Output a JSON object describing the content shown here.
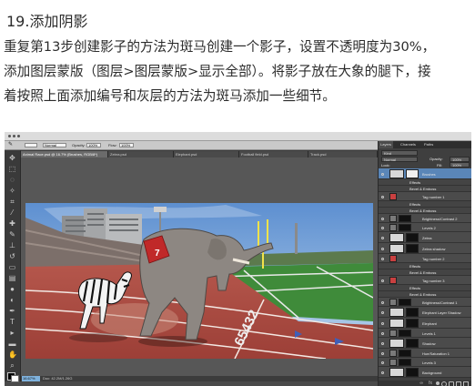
{
  "tutorial": {
    "step_title": "19.添加阴影",
    "lines": [
      "重复第13步创建影子的方法为斑马创建一个影子，设置不透明度为30%，",
      "添加图层蒙版（图层>图层蒙版>显示全部）。将影子放在大象的腿下，接",
      "着按照上面添加编号和灰层的方法为斑马添加一些细节。"
    ]
  },
  "photoshop": {
    "options_bar": {
      "mode": "Normal",
      "opacity_label": "Opacity:",
      "opacity": "100%",
      "flow_label": "Flow:",
      "flow": "100%",
      "workspace": "Essentials"
    },
    "document_tabs": [
      "Animal Race.psd @ 16.7% (Brushes, RGB/8*)",
      "Zebra.psd",
      "Elephant.psd",
      "Football field.psd",
      "Track.psd"
    ],
    "status": {
      "zoom": "16.67%",
      "text": "Doc: 42.2M/1.26G"
    },
    "panels": {
      "tabs": [
        "Layers",
        "Channels",
        "Paths"
      ],
      "filter_label": "Kind",
      "blend_mode": "Normal",
      "opacity_label": "Opacity:",
      "opacity": "100%",
      "lock_label": "Lock:",
      "fill_label": "Fill:",
      "fill": "100%",
      "layers": [
        {
          "name": "Brushes",
          "type": "main",
          "selected": true
        },
        {
          "name": "Effects",
          "type": "sub"
        },
        {
          "name": "Bevel & Emboss",
          "type": "sub"
        },
        {
          "name": "Tag number 1",
          "type": "text"
        },
        {
          "name": "Effects",
          "type": "sub"
        },
        {
          "name": "Bevel & Emboss",
          "type": "sub"
        },
        {
          "name": "Brightness/Contrast 2",
          "type": "adjust"
        },
        {
          "name": "Levels 2",
          "type": "adjust"
        },
        {
          "name": "Zebra",
          "type": "image"
        },
        {
          "name": "Zebra shadow",
          "type": "image"
        },
        {
          "name": "Tag number 2",
          "type": "text"
        },
        {
          "name": "Effects",
          "type": "sub"
        },
        {
          "name": "Bevel & Emboss",
          "type": "sub"
        },
        {
          "name": "Tag number 3",
          "type": "text"
        },
        {
          "name": "Effects",
          "type": "sub"
        },
        {
          "name": "Bevel & Emboss",
          "type": "sub"
        },
        {
          "name": "Brightness/Contrast 1",
          "type": "adjust"
        },
        {
          "name": "Elephant Layer Shadow",
          "type": "image"
        },
        {
          "name": "Elephant",
          "type": "image"
        },
        {
          "name": "Levels 1",
          "type": "adjust"
        },
        {
          "name": "Shadow",
          "type": "image"
        },
        {
          "name": "Hue/Saturation 1",
          "type": "adjust"
        },
        {
          "name": "Levels 3",
          "type": "adjust"
        },
        {
          "name": "Background",
          "type": "image"
        }
      ]
    }
  },
  "scene": {
    "bib_number": "7",
    "track_lane_number": "65432"
  },
  "colors": {
    "text": "#2b2b2b",
    "ps_dark": "#3a3a3a",
    "selection": "#5a86b8",
    "zoom_highlight": "#7fb2dd"
  }
}
